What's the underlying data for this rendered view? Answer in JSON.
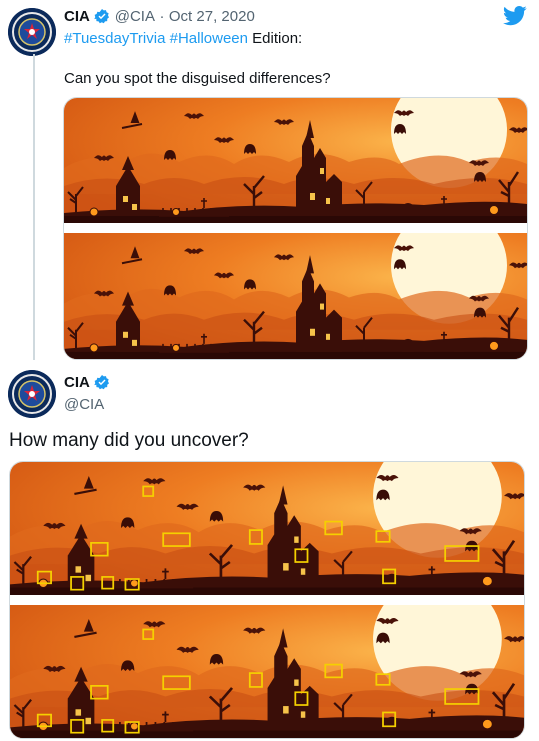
{
  "tweet1": {
    "name": "CIA",
    "handle": "@CIA",
    "separator": "·",
    "date": "Oct 27, 2020",
    "hashtags": [
      "#TuesdayTrivia",
      "#Halloween"
    ],
    "hashtag_suffix": "Edition:",
    "body": "Can you spot the disguised differences?"
  },
  "tweet2": {
    "name": "CIA",
    "handle": "@CIA",
    "body": "How many did you uncover?"
  },
  "icons": {
    "avatar": "cia-seal-icon",
    "verified": "verified-badge-icon",
    "brand": "twitter-bird-icon"
  },
  "colors": {
    "hashtag": "#1d9bf0",
    "highlight_box": "#f5d000",
    "sky_orange": "#e8731f",
    "moon": "#fff6d8"
  }
}
